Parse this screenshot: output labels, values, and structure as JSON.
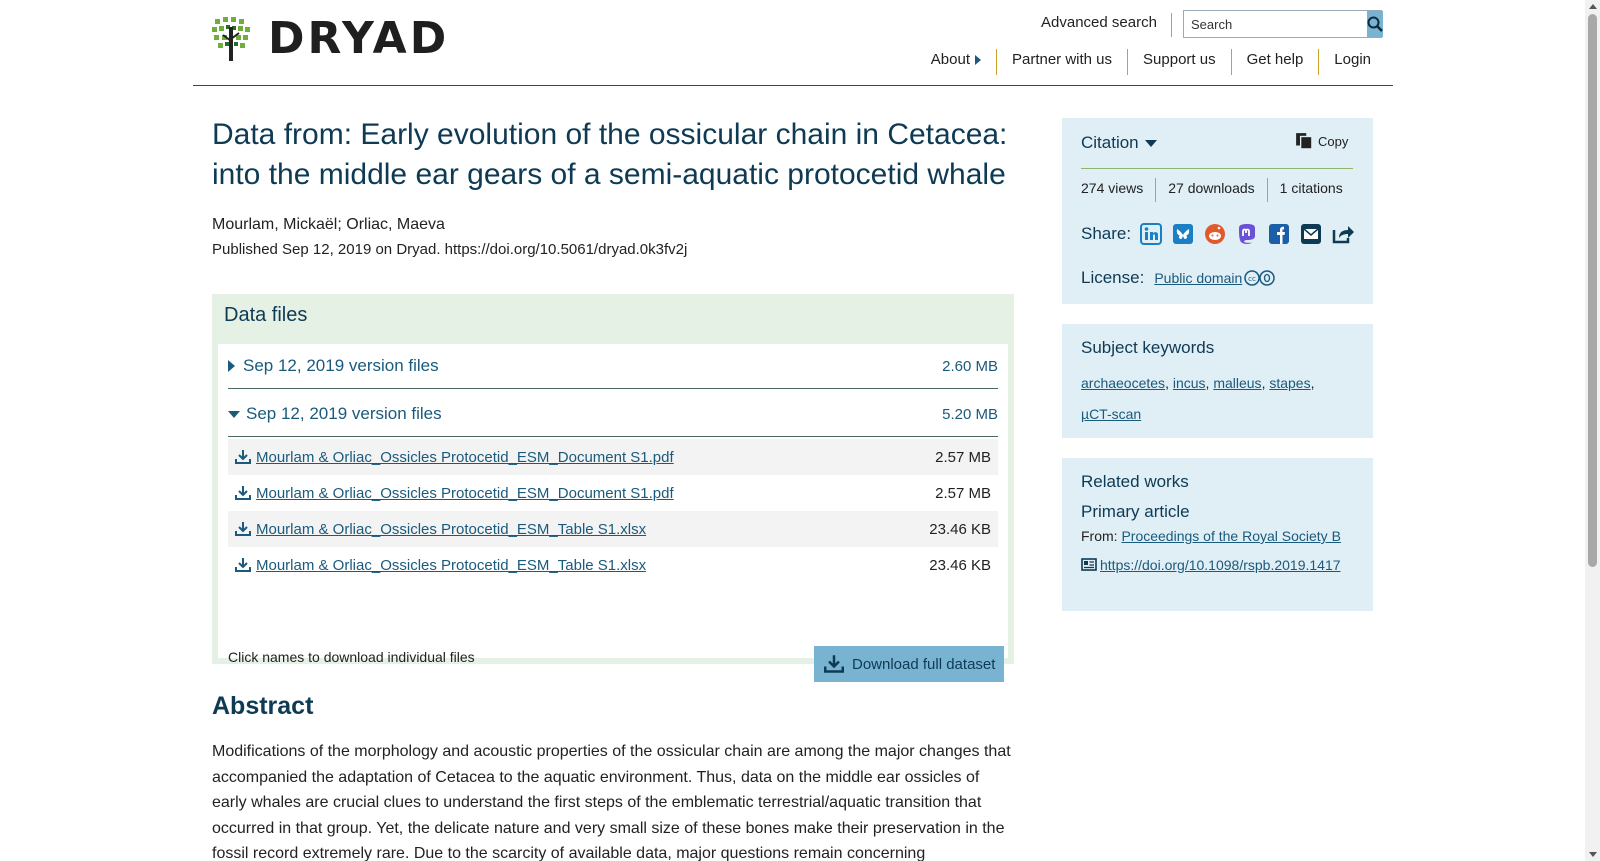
{
  "header": {
    "logo_text": "DRYAD",
    "advanced_search": "Advanced search",
    "search_placeholder": "Search",
    "nav": [
      "About",
      "Partner with us",
      "Support us",
      "Get help",
      "Login"
    ]
  },
  "dataset": {
    "title": "Data from: Early evolution of the ossicular chain in Cetacea: into the middle ear gears of a semi-aquatic protocetid whale",
    "authors": "Mourlam, Mickaël; Orliac, Maeva",
    "published": "Published Sep 12, 2019 on Dryad. https://doi.org/10.5061/dryad.0k3fv2j"
  },
  "data_files": {
    "heading": "Data files",
    "versions": [
      {
        "label": "Sep 12, 2019 version files",
        "size": "2.60 MB",
        "expanded": false
      },
      {
        "label": "Sep 12, 2019 version files",
        "size": "5.20 MB",
        "expanded": true
      }
    ],
    "files": [
      {
        "name": "Mourlam & Orliac_Ossicles Protocetid_ESM_Document S1.pdf",
        "size": "2.57 MB"
      },
      {
        "name": "Mourlam & Orliac_Ossicles Protocetid_ESM_Document S1.pdf",
        "size": "2.57 MB"
      },
      {
        "name": "Mourlam & Orliac_Ossicles Protocetid_ESM_Table S1.xlsx",
        "size": "23.46 KB"
      },
      {
        "name": "Mourlam & Orliac_Ossicles Protocetid_ESM_Table S1.xlsx",
        "size": "23.46 KB"
      }
    ],
    "note": "Click names to download individual files",
    "download_full": "Download full dataset"
  },
  "abstract": {
    "heading": "Abstract",
    "text": "Modifications of the morphology and acoustic properties of the ossicular chain are among the major changes that accompanied the adaptation of Cetacea to the aquatic environment. Thus, data on the middle ear ossicles of early whales are crucial clues to understand the first steps of the emblematic terrestrial/aquatic transition that occurred in that group. Yet, the delicate nature and very small size of these bones make their preservation in the fossil record extremely rare. Due to the scarcity of available data, major questions remain concerning"
  },
  "sidebar": {
    "citation": "Citation",
    "copy": "Copy",
    "metrics": [
      "274 views",
      "27 downloads",
      "1 citations"
    ],
    "share_label": "Share:",
    "share_icons": [
      "linkedin-icon",
      "bluesky-icon",
      "reddit-icon",
      "mastodon-icon",
      "facebook-icon",
      "email-icon",
      "share-icon"
    ],
    "license_label": "License:",
    "license_link": "Public domain",
    "keywords_heading": "Subject keywords",
    "keywords": [
      "archaeocetes",
      "incus",
      "malleus",
      "stapes",
      "µCT-scan"
    ],
    "related_heading": "Related works",
    "related_sub": "Primary article",
    "related_from_label": "From:",
    "related_from_link": "Proceedings of the Royal Society B",
    "related_doi": "https://doi.org/10.1098/rspb.2019.1417"
  },
  "colors": {
    "brand_blue": "#1a5a7c",
    "title_navy": "#0e3a54",
    "files_bg": "#e5f1e4",
    "side_bg": "#e0eef5",
    "button_blue": "#78b4d2",
    "separator_gold": "#c9a227"
  }
}
